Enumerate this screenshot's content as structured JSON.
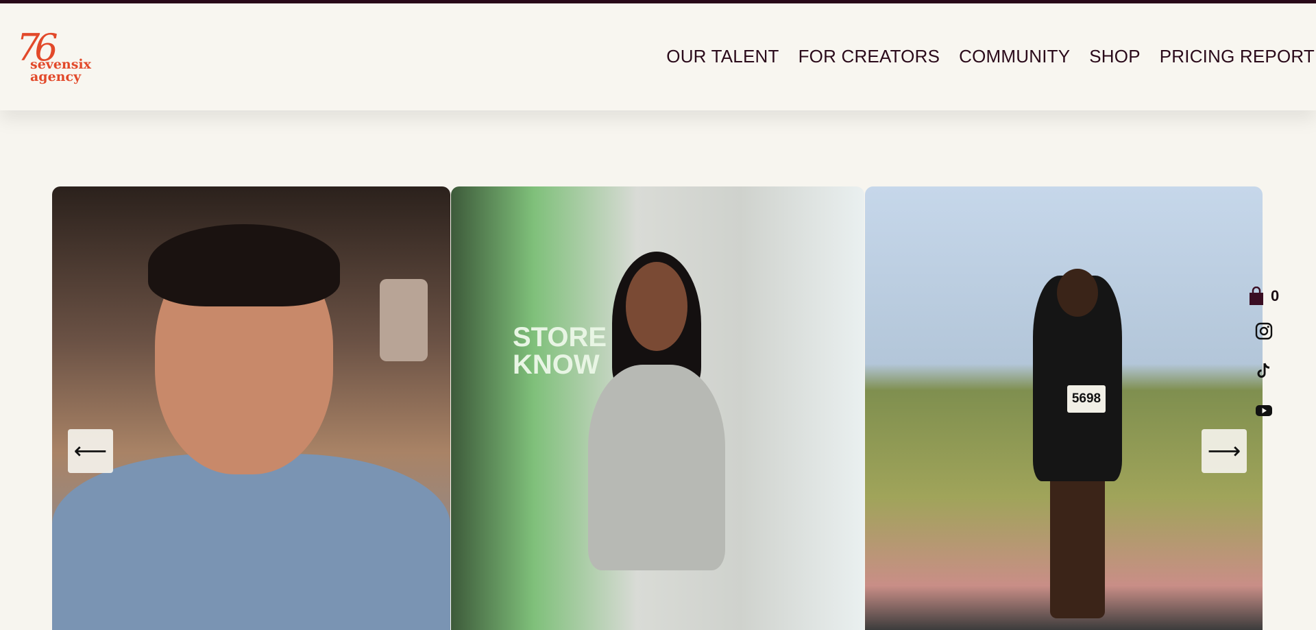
{
  "brand": {
    "logo_number": "76",
    "logo_line1": "sevensix",
    "logo_line2": "agency",
    "accent_color": "#e2492a",
    "dark_color": "#2a0a1a",
    "background": "#f7f5ef"
  },
  "nav": {
    "items": [
      {
        "label": "OUR TALENT"
      },
      {
        "label": "FOR CREATORS"
      },
      {
        "label": "COMMUNITY"
      },
      {
        "label": "SHOP"
      },
      {
        "label": "PRICING REPORT"
      }
    ]
  },
  "carousel": {
    "prev_icon": "arrow-left-icon",
    "prev_label": "⟵",
    "next_icon": "arrow-right-icon",
    "next_label": "⟶",
    "slides": [
      {
        "image": "makeup-artist-photo"
      },
      {
        "image": "nike-sweatsuit-creator-photo",
        "sign_text": "STORE\nKNOW"
      },
      {
        "image": "runner-photo",
        "bib_number": "5698"
      }
    ]
  },
  "sidebar": {
    "cart_icon": "shopping-bag-icon",
    "cart_count": "0",
    "social": [
      "instagram-icon",
      "tiktok-icon",
      "youtube-icon"
    ]
  }
}
